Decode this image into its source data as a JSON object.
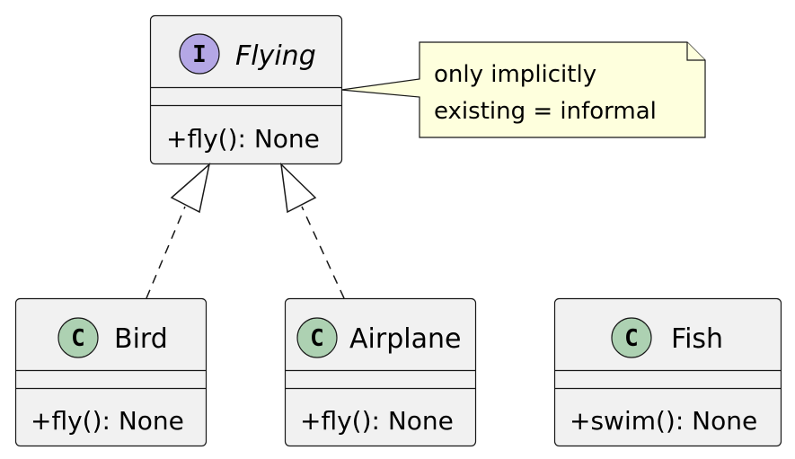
{
  "diagram": {
    "type": "uml-class",
    "colors": {
      "class_fill": "#F1F1F1",
      "border": "#181818",
      "interface_badge": "#B4A7E5",
      "class_badge": "#ADD1B2",
      "note_fill": "#FEFFDD"
    },
    "interface": {
      "badge": "I",
      "name": "Flying",
      "methods": [
        "+fly(): None"
      ]
    },
    "classes": [
      {
        "badge": "C",
        "name": "Bird",
        "methods": [
          "+fly(): None"
        ]
      },
      {
        "badge": "C",
        "name": "Airplane",
        "methods": [
          "+fly(): None"
        ]
      },
      {
        "badge": "C",
        "name": "Fish",
        "methods": [
          "+swim(): None"
        ]
      }
    ],
    "note": {
      "lines": [
        "only implicitly",
        "existing = informal"
      ]
    },
    "relations": [
      {
        "from": "Bird",
        "to": "Flying",
        "type": "realization"
      },
      {
        "from": "Airplane",
        "to": "Flying",
        "type": "realization"
      }
    ]
  }
}
